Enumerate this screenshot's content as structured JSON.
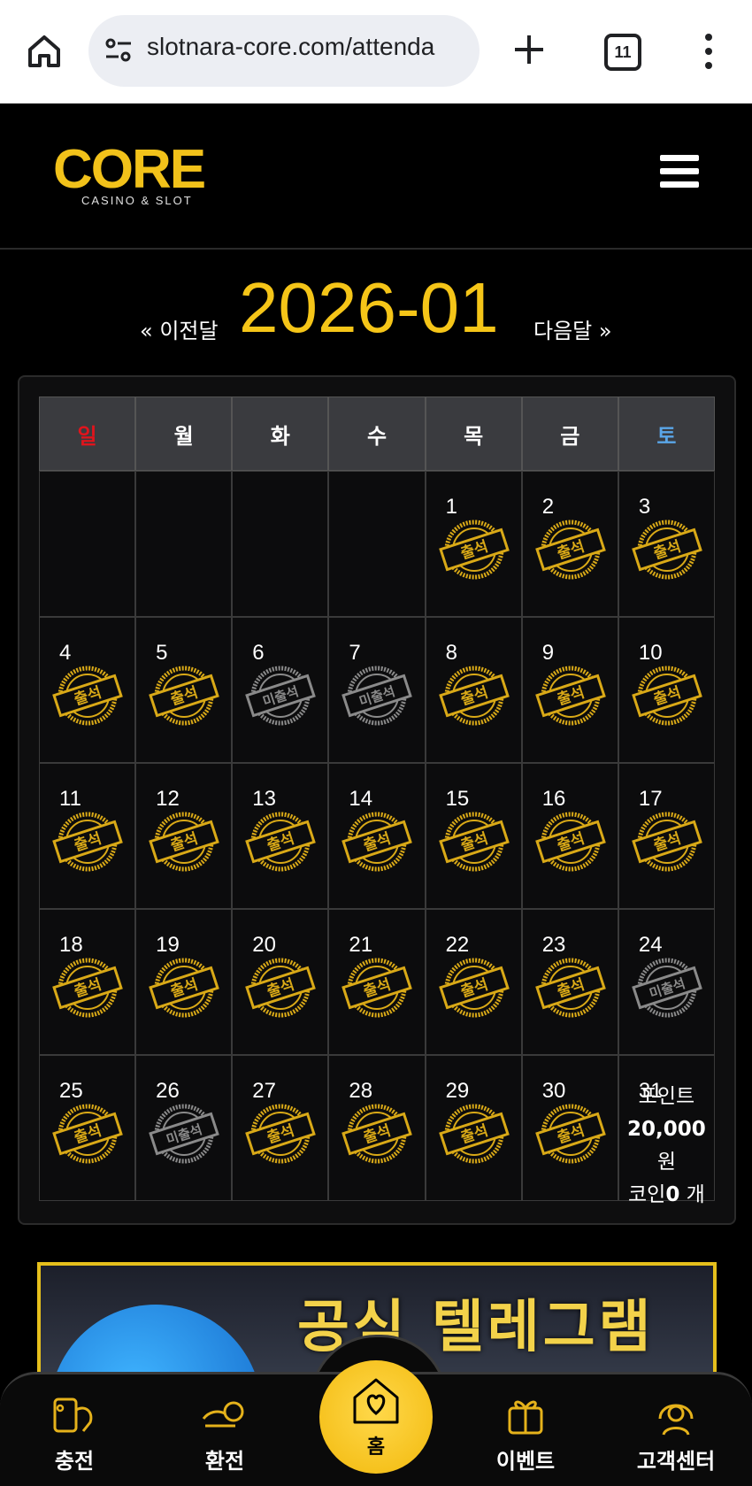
{
  "browser": {
    "url": "slotnara-core.com/attenda",
    "tab_count": "11"
  },
  "brand": {
    "logo_text": "CORE",
    "logo_sub": "CASINO & SLOT"
  },
  "month_nav": {
    "prev": "« 이전달",
    "title": "2026-01",
    "next": "다음달 »"
  },
  "calendar": {
    "weekdays": [
      "일",
      "월",
      "화",
      "수",
      "목",
      "금",
      "토"
    ],
    "stamp_attended": "출석",
    "stamp_missed": "미출석",
    "weeks": [
      [
        null,
        null,
        null,
        null,
        {
          "day": "1",
          "status": "attended"
        },
        {
          "day": "2",
          "status": "attended"
        },
        {
          "day": "3",
          "status": "attended"
        }
      ],
      [
        {
          "day": "4",
          "status": "attended"
        },
        {
          "day": "5",
          "status": "attended"
        },
        {
          "day": "6",
          "status": "missed"
        },
        {
          "day": "7",
          "status": "missed"
        },
        {
          "day": "8",
          "status": "attended"
        },
        {
          "day": "9",
          "status": "attended"
        },
        {
          "day": "10",
          "status": "attended"
        }
      ],
      [
        {
          "day": "11",
          "status": "attended"
        },
        {
          "day": "12",
          "status": "attended"
        },
        {
          "day": "13",
          "status": "attended"
        },
        {
          "day": "14",
          "status": "attended"
        },
        {
          "day": "15",
          "status": "attended"
        },
        {
          "day": "16",
          "status": "attended"
        },
        {
          "day": "17",
          "status": "attended"
        }
      ],
      [
        {
          "day": "18",
          "status": "attended"
        },
        {
          "day": "19",
          "status": "attended"
        },
        {
          "day": "20",
          "status": "attended"
        },
        {
          "day": "21",
          "status": "attended"
        },
        {
          "day": "22",
          "status": "attended"
        },
        {
          "day": "23",
          "status": "attended"
        },
        {
          "day": "24",
          "status": "missed"
        }
      ],
      [
        {
          "day": "25",
          "status": "attended"
        },
        {
          "day": "26",
          "status": "missed"
        },
        {
          "day": "27",
          "status": "attended"
        },
        {
          "day": "28",
          "status": "attended"
        },
        {
          "day": "29",
          "status": "attended"
        },
        {
          "day": "30",
          "status": "attended"
        },
        {
          "day": "31",
          "status": "summary"
        }
      ]
    ],
    "summary": {
      "point_label": "포인트",
      "point_value": "20,000",
      "point_unit": "원",
      "coin_label": "코인",
      "coin_value": "0",
      "coin_unit": "개"
    }
  },
  "banner": {
    "title": "공식 텔레그램"
  },
  "bottom_nav": {
    "deposit": "충전",
    "withdraw": "환전",
    "home": "홈",
    "event": "이벤트",
    "support": "고객센터"
  },
  "colors": {
    "accent": "#f5c518",
    "sunday": "#e0141c",
    "saturday": "#5aa6e8",
    "stamp_attended": "#d9a917",
    "stamp_missed": "#8a8a8a"
  }
}
